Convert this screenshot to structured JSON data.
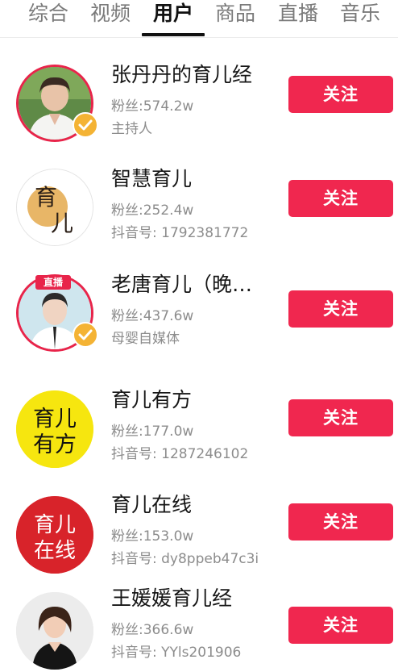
{
  "tabs": [
    {
      "label": "综合"
    },
    {
      "label": "视频"
    },
    {
      "label": "用户"
    },
    {
      "label": "商品"
    },
    {
      "label": "直播"
    },
    {
      "label": "音乐"
    }
  ],
  "active_tab": "用户",
  "colors": {
    "accent": "#f0274f",
    "verify_badge": "#f4b334",
    "live_ring": "#e8244a"
  },
  "users": [
    {
      "name": "张丹丹的育儿经",
      "fans": "粉丝:574.2w",
      "sub": "主持人",
      "verified": true,
      "button": "关注"
    },
    {
      "name": "智慧育儿",
      "fans": "粉丝:252.4w",
      "sub": "抖音号: 1792381772",
      "verified": false,
      "button": "关注",
      "avatar_text": [
        "育",
        "儿"
      ]
    },
    {
      "name": "老唐育儿（晚…",
      "fans": "粉丝:437.6w",
      "sub": "母婴自媒体",
      "verified": true,
      "live_badge": "直播",
      "button": "关注"
    },
    {
      "name": "育儿有方",
      "fans": "粉丝:177.0w",
      "sub": "抖音号: 1287246102",
      "verified": false,
      "button": "关注",
      "avatar_text": [
        "育儿",
        "有方"
      ]
    },
    {
      "name": "育儿在线",
      "fans": "粉丝:153.0w",
      "sub": "抖音号: dy8ppeb47c3i",
      "verified": false,
      "button": "关注",
      "avatar_text": [
        "育儿",
        "在线"
      ]
    },
    {
      "name": "王媛媛育儿经",
      "fans": "粉丝:366.6w",
      "sub": "抖音号: YYls201906",
      "verified": false,
      "button": "关注"
    }
  ]
}
